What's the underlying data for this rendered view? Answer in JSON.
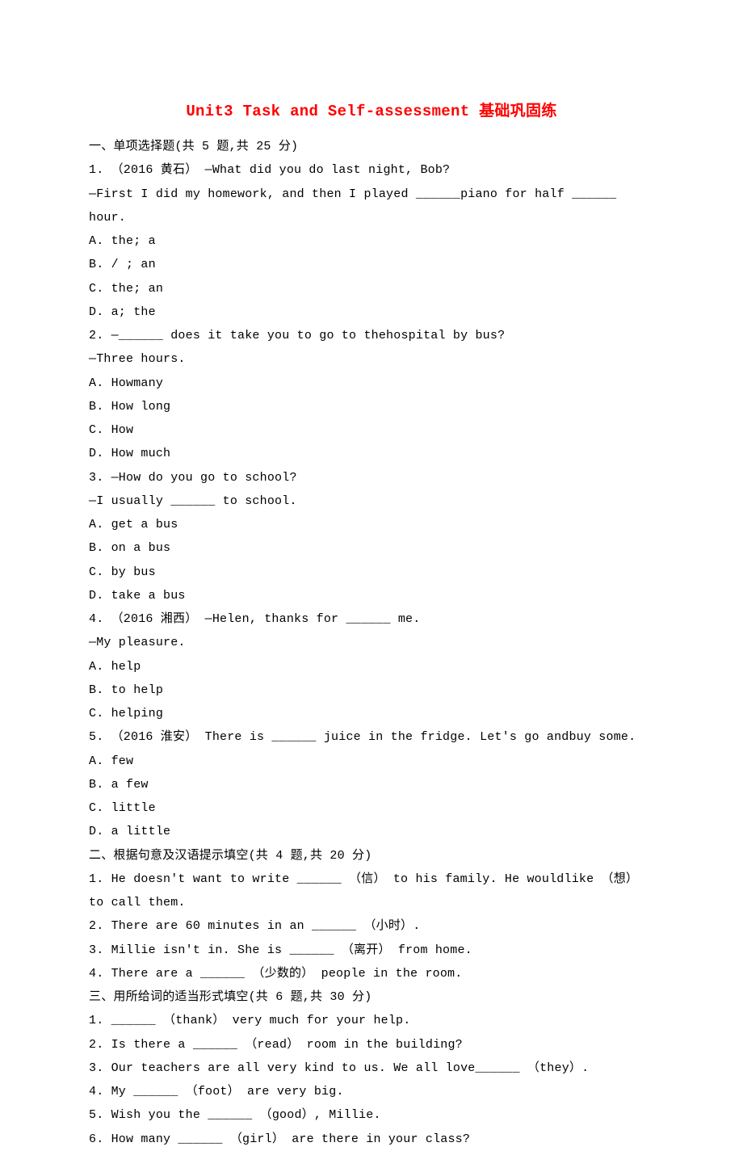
{
  "title": "Unit3 Task and Self-assessment 基础巩固练",
  "lines": [
    "一、单项选择题(共 5 题,共 25 分)",
    "1. （2016 黄石） —What did you do last night, Bob?",
    "—First I did my homework, and then I played ______piano for half ______ hour.",
    "A. the; a",
    "B. / ; an",
    "C. the; an",
    "D. a; the",
    "2. —______ does it take you to go to thehospital by bus?",
    "—Three hours.",
    "A. Howmany",
    "B. How long",
    "C. How",
    "D. How much",
    "3. —How do you go to school?",
    "—I usually ______ to school.",
    "A. get a bus",
    "B. on a bus",
    "C. by bus",
    "D. take a bus",
    "4. （2016 湘西） —Helen, thanks for ______ me.",
    "—My pleasure.",
    "A. help",
    "B. to help",
    "C. helping",
    "5. （2016 淮安） There is ______ juice in the fridge. Let's go andbuy some.",
    "A. few",
    "B. a few",
    "C. little",
    "D. a little",
    "二、根据句意及汉语提示填空(共 4 题,共 20 分)",
    "1. He doesn't want to write ______ （信） to his family. He wouldlike （想） to call them.",
    "2. There are 60 minutes in an ______ （小时）.",
    "3. Millie isn't in. She is ______ （离开） from home.",
    "4. There are a ______ （少数的） people in the room.",
    "三、用所给词的适当形式填空(共 6 题,共 30 分)",
    "1. ______ （thank） very much for your help.",
    "2. Is there a ______ （read） room in the building?",
    "3. Our teachers are all very kind to us. We all love______ （they）.",
    "4. My ______ （foot） are very big.",
    "5. Wish you the ______ （good）, Millie.",
    "6. How many ______ （girl） are there in your class?"
  ]
}
